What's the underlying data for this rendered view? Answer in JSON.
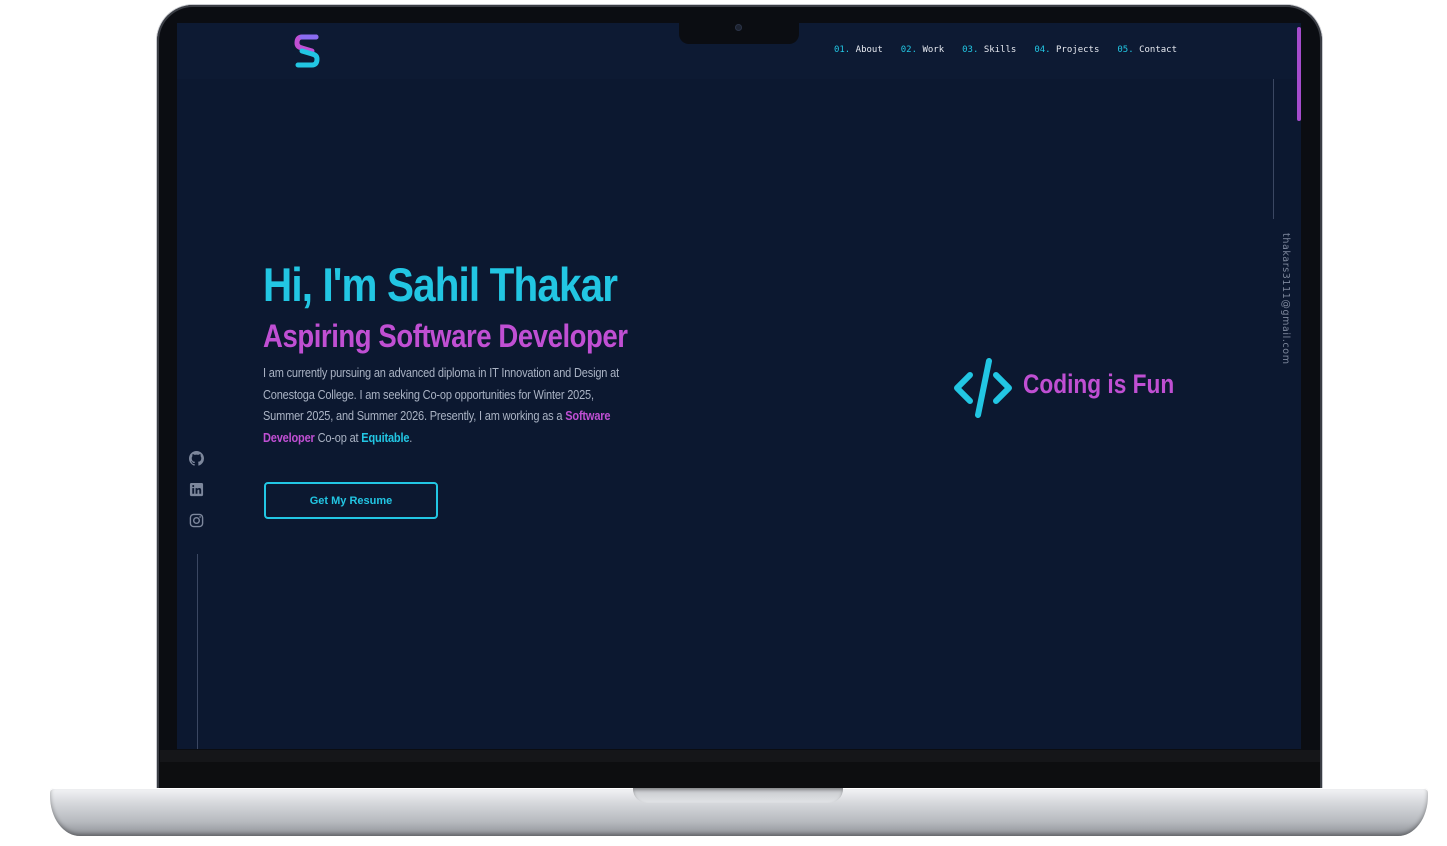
{
  "colors": {
    "background": "#0c1830",
    "accent_cyan": "#22c6e3",
    "accent_purple": "#c04fd3",
    "text_muted": "#aab3c4"
  },
  "header": {
    "logo_icon": "s-logo-icon",
    "nav": [
      {
        "num": "01.",
        "label": "About"
      },
      {
        "num": "02.",
        "label": "Work"
      },
      {
        "num": "03.",
        "label": "Skills"
      },
      {
        "num": "04.",
        "label": "Projects"
      },
      {
        "num": "05.",
        "label": "Contact"
      }
    ]
  },
  "sidebar_right": {
    "email": "thakars3111@gmail.com"
  },
  "sidebar_left": {
    "icons": [
      "github-icon",
      "linkedin-icon",
      "instagram-icon"
    ]
  },
  "hero": {
    "title": "Hi, I'm Sahil Thakar",
    "subtitle": "Aspiring Software Developer",
    "desc_part1": "I am currently pursuing an advanced diploma in IT Innovation and Design at Conestoga College. I am seeking Co-op opportunities for Winter 2025, Summer 2025, and Summer 2026. Presently, I am working as a ",
    "desc_highlight1": "Software Developer",
    "desc_part2": " Co-op at ",
    "desc_highlight2": "Equitable",
    "desc_part3": ".",
    "button_label": "Get My Resume"
  },
  "tagline": {
    "icon": "code-brackets-icon",
    "text": "Coding is Fun"
  }
}
